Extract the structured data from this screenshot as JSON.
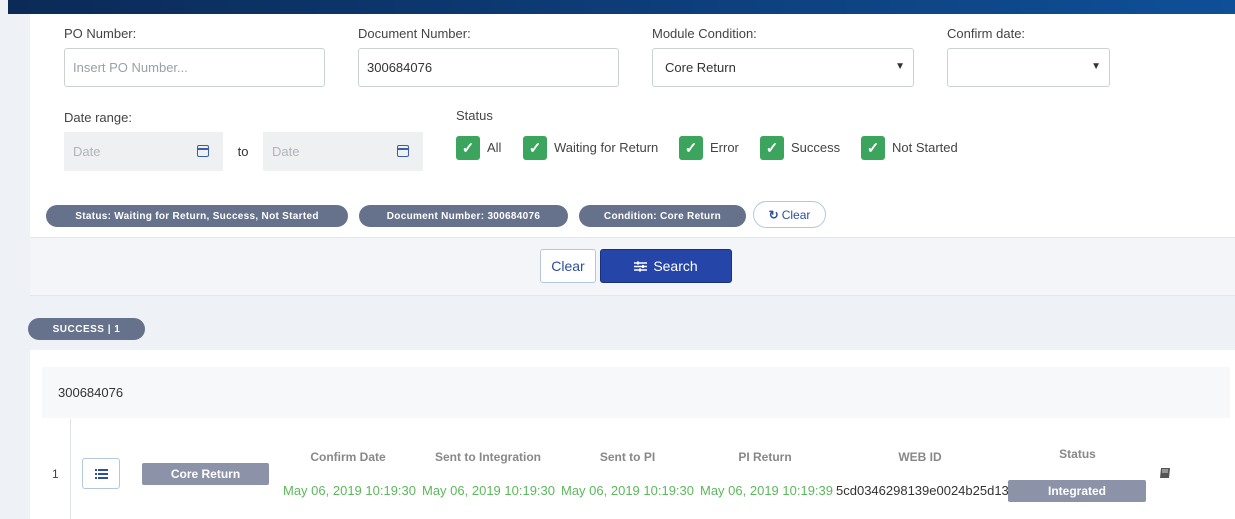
{
  "filters": {
    "po_number": {
      "label": "PO Number:",
      "placeholder": "Insert PO Number..."
    },
    "document_number": {
      "label": "Document Number:",
      "value": "300684076"
    },
    "module_condition": {
      "label": "Module Condition:",
      "value": "Core Return"
    },
    "confirm_date": {
      "label": "Confirm date:",
      "value": ""
    },
    "date_range": {
      "label": "Date range:",
      "from_placeholder": "Date",
      "to_label": "to",
      "to_placeholder": "Date"
    },
    "status": {
      "label": "Status",
      "options": [
        {
          "label": "All",
          "checked": true
        },
        {
          "label": "Waiting for Return",
          "checked": true
        },
        {
          "label": "Error",
          "checked": true
        },
        {
          "label": "Success",
          "checked": true
        },
        {
          "label": "Not Started",
          "checked": true
        }
      ]
    }
  },
  "active_filters": {
    "chips": [
      "Status: Waiting for Return, Success, Not Started",
      "Document Number: 300684076",
      "Condition: Core Return"
    ],
    "clear_label": "Clear"
  },
  "actions": {
    "clear_label": "Clear",
    "search_label": "Search"
  },
  "results": {
    "badge": "SUCCESS | 1",
    "group_title": "300684076",
    "columns": [
      "Confirm Date",
      "Sent to Integration",
      "Sent to PI",
      "PI Return",
      "WEB ID",
      "Status"
    ],
    "row": {
      "index": "1",
      "condition": "Core Return",
      "confirm_date": "May 06, 2019 10:19:30",
      "sent_to_integration": "May 06, 2019 10:19:30",
      "sent_to_pi": "May 06, 2019 10:19:30",
      "pi_return": "May 06, 2019 10:19:39",
      "web_id": "5cd0346298139e0024b25d13",
      "status": "Integrated"
    }
  },
  "colors": {
    "accent": "#2546a8",
    "success": "#3ba55d",
    "chip": "#66728c",
    "date_text": "#5cb85c"
  },
  "icons": [
    "calendar-icon",
    "check-icon",
    "refresh-icon",
    "sliders-icon",
    "list-icon",
    "book-icon"
  ]
}
